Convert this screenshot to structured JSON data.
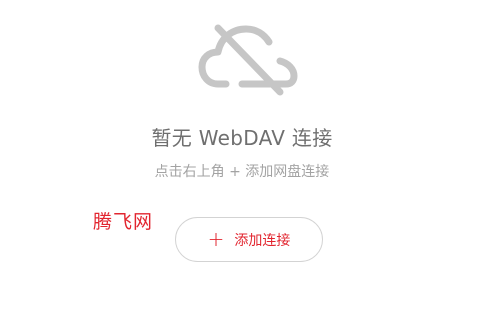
{
  "empty_state": {
    "icon": "cloud-off-icon",
    "title": "暂无 WebDAV 连接",
    "hint": "点击右上角 + 添加网盘连接"
  },
  "watermark": {
    "text": "腾飞网"
  },
  "add_button": {
    "icon_glyph": "+",
    "label": "添加连接"
  },
  "colors": {
    "accent": "#e2252f",
    "icon_gray": "#c6c6c6",
    "title_gray": "#6f6f6f",
    "hint_gray": "#a3a3a3",
    "button_border": "#d3d3d3"
  }
}
